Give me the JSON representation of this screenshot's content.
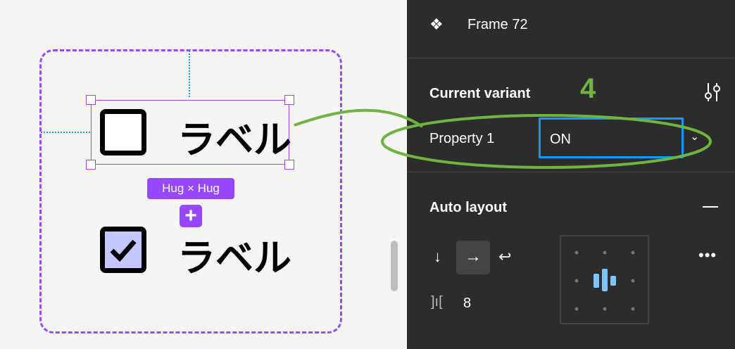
{
  "canvas": {
    "item_label_1": "ラベル",
    "item_label_2": "ラベル",
    "size_badge": "Hug × Hug",
    "add_icon": "plus-icon"
  },
  "panel": {
    "title": "Frame 72",
    "current_variant": {
      "heading": "Current variant",
      "annotation_number": "4",
      "property_label": "Property 1",
      "property_value": "ON"
    },
    "auto_layout": {
      "heading": "Auto layout",
      "gap_value": "8"
    }
  },
  "colors": {
    "accent": "#9747ff",
    "annotation": "#6fb43f",
    "selection": "#0d99ff",
    "panel_bg": "#2c2c2c"
  }
}
